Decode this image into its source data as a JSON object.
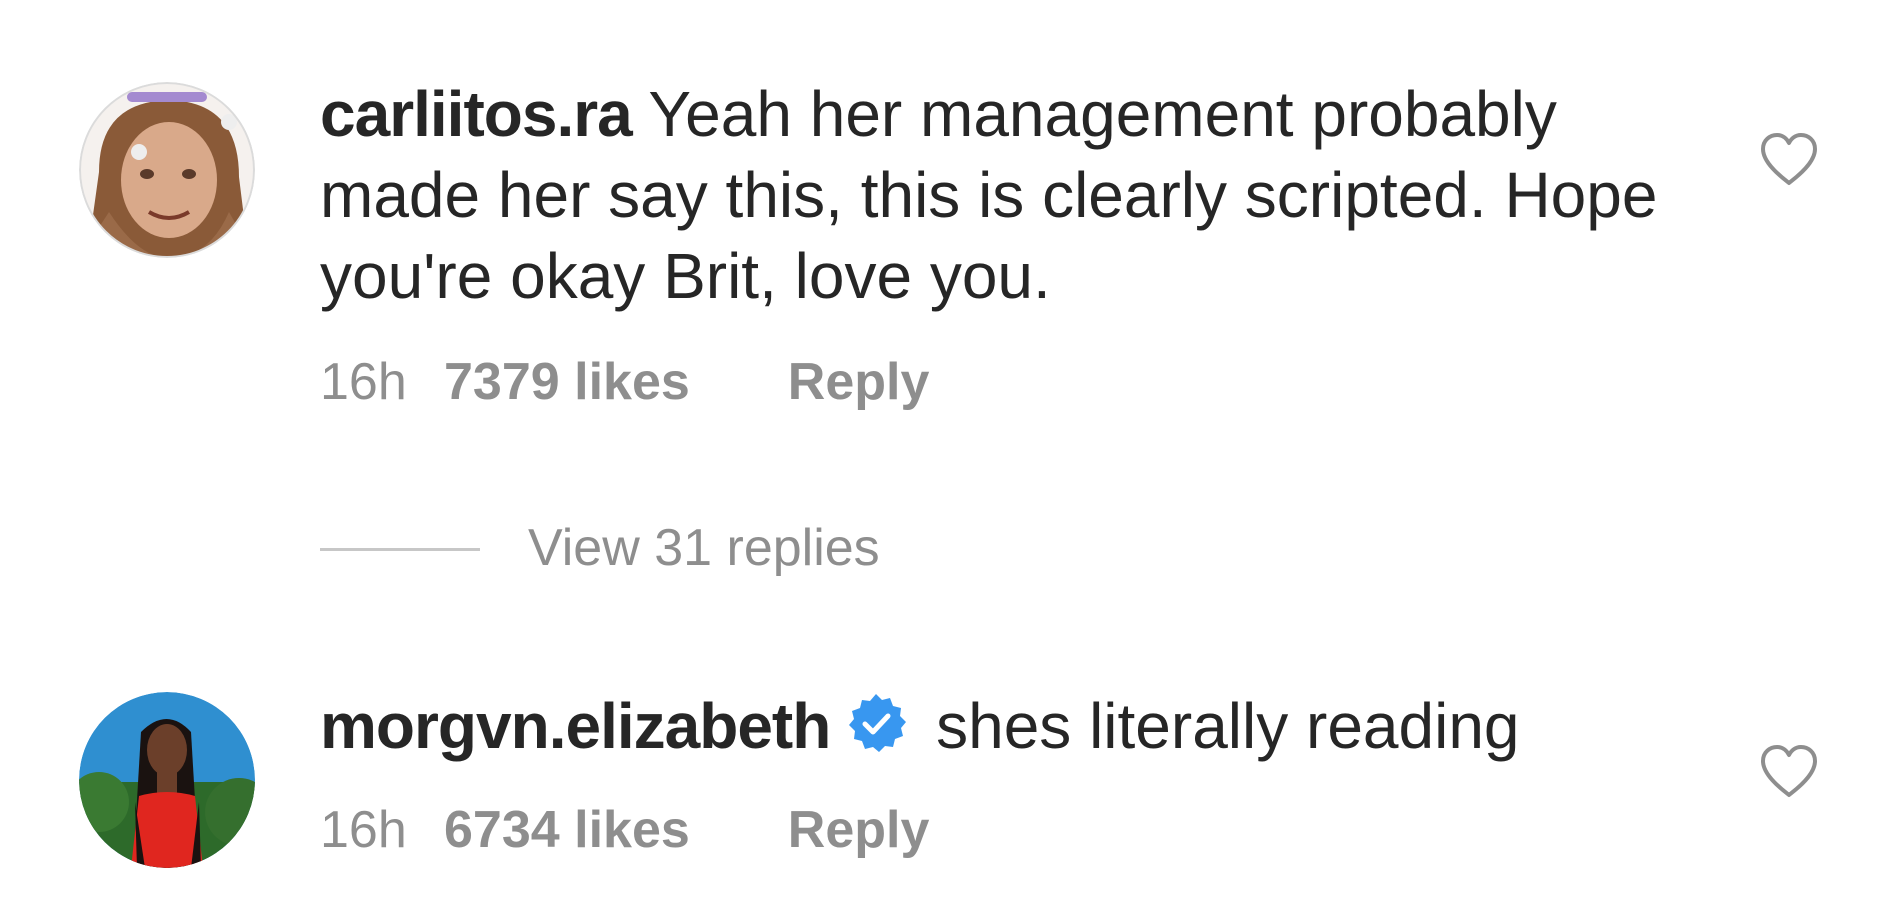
{
  "comments": [
    {
      "username": "carliitos.ra",
      "text": "Yeah her management probably made her say this, this is clearly scripted. Hope you're okay Brit, love you.",
      "time": "16h",
      "likes": "7379 likes",
      "reply_label": "Reply",
      "verified": false
    },
    {
      "username": "morgvn.elizabeth",
      "text": "shes literally reading",
      "time": "16h",
      "likes": "6734 likes",
      "reply_label": "Reply",
      "verified": true
    }
  ],
  "view_replies_label": "View 31 replies",
  "icons": {
    "like": "heart-outline-icon",
    "verified": "verified-badge-icon"
  },
  "colors": {
    "text": "#262626",
    "secondary_text": "#8e8e8e",
    "divider": "#c7c7c7",
    "verified_blue": "#3897f0"
  }
}
